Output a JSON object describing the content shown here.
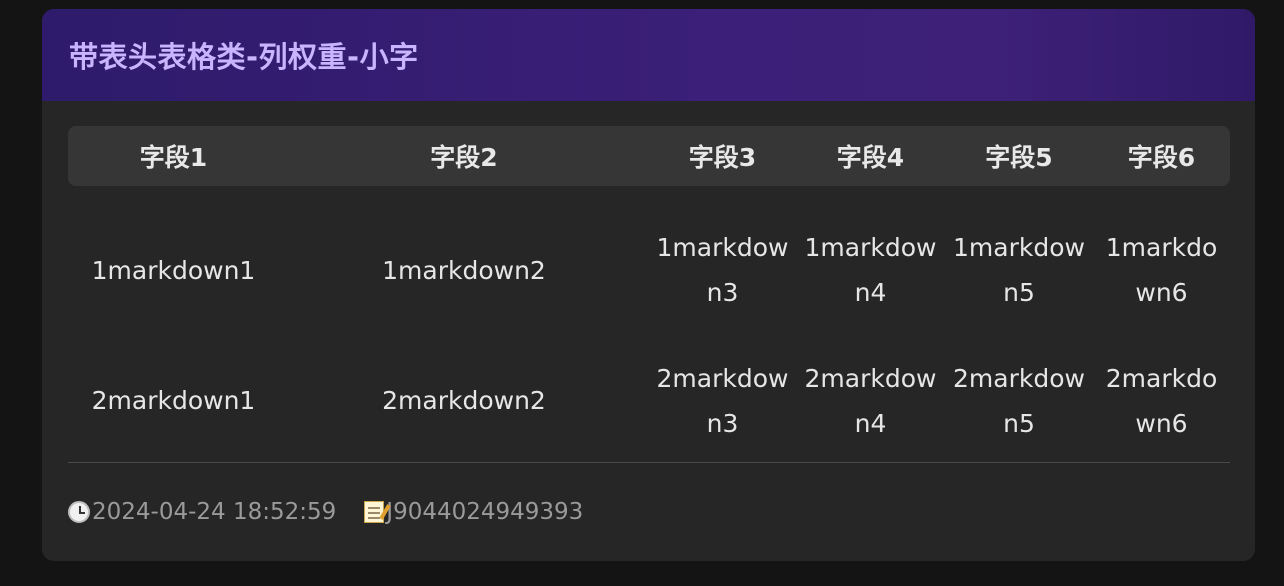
{
  "card": {
    "title": "带表头表格类-列权重-小字"
  },
  "table": {
    "headers": [
      "字段1",
      "字段2",
      "字段3",
      "字段4",
      "字段5",
      "字段6"
    ],
    "rows": [
      [
        "1markdown1",
        "1markdown2",
        "1markdown3",
        "1markdown4",
        "1markdown5",
        "1markdown6"
      ],
      [
        "2markdown1",
        "2markdown2",
        "2markdown3",
        "2markdown4",
        "2markdown5",
        "2markdown6"
      ]
    ]
  },
  "footer": {
    "timestamp": "2024-04-24 18:52:59",
    "record_id": "J9044024949393",
    "timestamp_icon": "clock-icon",
    "record_icon": "memo-icon"
  },
  "colors": {
    "header_gradient_start": "#2e1b6b",
    "header_gradient_end": "#3e2078",
    "title_color": "#c9b4ff",
    "card_background": "#262626",
    "table_header_background": "#363636"
  }
}
